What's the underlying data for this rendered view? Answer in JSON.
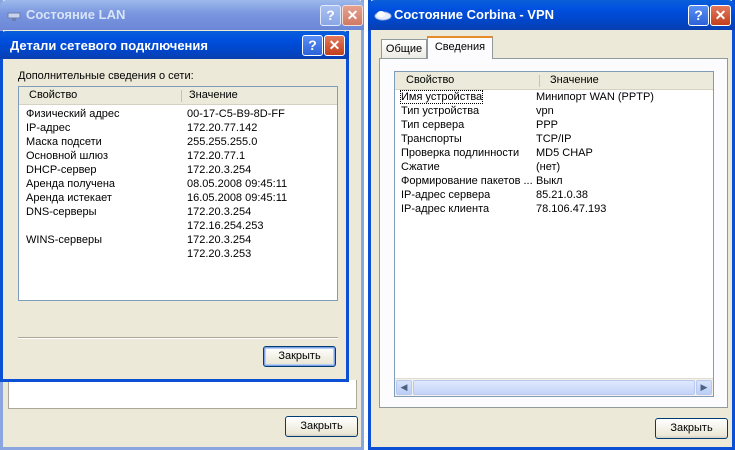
{
  "lan_window": {
    "title": "Состояние LAN",
    "close_button": "Закрыть"
  },
  "details_dialog": {
    "title": "Детали сетевого подключения",
    "subtitle": "Дополнительные сведения о сети:",
    "columns": [
      "Свойство",
      "Значение"
    ],
    "rows": [
      {
        "property": "Физический адрес",
        "value": "00-17-C5-B9-8D-FF"
      },
      {
        "property": "IP-адрес",
        "value": "172.20.77.142"
      },
      {
        "property": "Маска подсети",
        "value": "255.255.255.0"
      },
      {
        "property": "Основной шлюз",
        "value": "172.20.77.1"
      },
      {
        "property": "DHCP-сервер",
        "value": "172.20.3.254"
      },
      {
        "property": "Аренда получена",
        "value": "08.05.2008 09:45:11"
      },
      {
        "property": "Аренда истекает",
        "value": "16.05.2008 09:45:11"
      },
      {
        "property": "DNS-серверы",
        "value": "172.20.3.254"
      },
      {
        "property": "",
        "value": "172.16.254.253"
      },
      {
        "property": "WINS-серверы",
        "value": "172.20.3.254"
      },
      {
        "property": "",
        "value": "172.20.3.253"
      }
    ],
    "close_button": "Закрыть"
  },
  "vpn_window": {
    "title": "Состояние Corbina - VPN",
    "tabs": [
      "Общие",
      "Сведения"
    ],
    "columns": [
      "Свойство",
      "Значение"
    ],
    "rows": [
      {
        "property": "Имя устройства",
        "value": "Минипорт WAN (PPTP)"
      },
      {
        "property": "Тип устройства",
        "value": "vpn"
      },
      {
        "property": "Тип сервера",
        "value": "PPP"
      },
      {
        "property": "Транспорты",
        "value": "TCP/IP"
      },
      {
        "property": "Проверка подлинности",
        "value": "MD5 CHAP"
      },
      {
        "property": "Сжатие",
        "value": "(нет)"
      },
      {
        "property": "Формирование пакетов ...",
        "value": "Выкл"
      },
      {
        "property": "IP-адрес сервера",
        "value": "85.21.0.38"
      },
      {
        "property": "IP-адрес клиента",
        "value": "78.106.47.193"
      }
    ],
    "close_button": "Закрыть"
  },
  "colors": {
    "active_titlebar": "#0054e3",
    "inactive_titlebar": "#7a96df",
    "dialog_face": "#ece9d8",
    "selected_tab_accent": "#e68b2c"
  }
}
